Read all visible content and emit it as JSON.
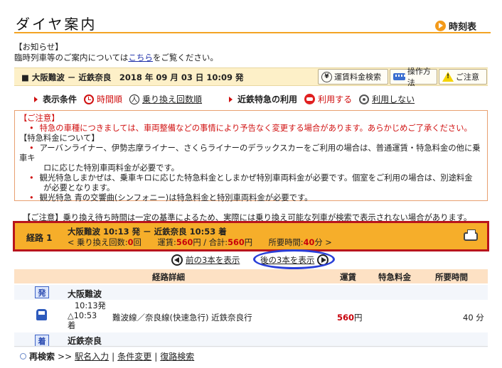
{
  "header": {
    "title": "ダイヤ案内",
    "timetable_link": "時刻表"
  },
  "notice": {
    "heading": "【お知らせ】",
    "text_before": "臨時列車等のご案内については",
    "link": "こちら",
    "text_after": "をご覧ください。"
  },
  "condition": {
    "summary": "■ 大阪難波 － 近鉄奈良　2018 年 09 月 03 日 10:09 発",
    "fare_search": "運賃料金検索",
    "how_to": "操作方法",
    "caution": "ご注意"
  },
  "options": {
    "display_label": "表示条件",
    "time_order": "時間順",
    "transfer_count_order": "乗り換え回数順",
    "express_label": "近鉄特急の利用",
    "use": "利用する",
    "no_use": "利用しない"
  },
  "caution_box": {
    "heading": "【ご注意】",
    "line1": "特急の車種につきましては、車両整備などの事情により予告なく変更する場合があります。あらかじめご了承ください。",
    "fare_heading": "【特急料金について】",
    "bullet1a": "アーバンライナー、伊勢志摩ライナー、さくらライナーのデラックスカーをご利用の場合は、普通運賃・特急料金の他に乗車キ",
    "bullet1b": "ロに応じた特別車両料金が必要です。",
    "bullet2a": "観光特急しまかぜは、乗車キロに応じた特急料金としまかぜ特別車両料金が必要です。個室をご利用の場合は、別途料金",
    "bullet2b": "が必要となります。",
    "bullet3": "観光特急 青の交響曲(シンフォニー)は特急料金と特別車両料金が必要です。"
  },
  "transfer_note": "【ご注意】乗り換え待ち時間は一定の基準によるため、実際には乗り換え可能な列車が検索で表示されない場合があります。",
  "route": {
    "label": "経路 1",
    "summary": "大阪難波 10:13 発 － 近鉄奈良 10:53 着",
    "transfers_prefix": "< 乗り換え回数:",
    "transfers": "0",
    "transfers_unit": "回　　運賃:",
    "fare": "560",
    "fare_unit": "円 / 合計:",
    "total": "560",
    "total_unit": "円　　所要時間:",
    "duration": "40",
    "duration_unit": "分 >"
  },
  "pager": {
    "prev": "前の3本を表示",
    "next": "後の3本を表示"
  },
  "table": {
    "col_detail": "経路詳細",
    "col_fare": "運賃",
    "col_express": "特急料金",
    "col_time": "所要時間"
  },
  "segment": {
    "dep_badge": "発",
    "dep_station": "大阪難波",
    "dep_time": "10:13発",
    "arr_time": "△10:53",
    "arr_suffix": "着",
    "line": "難波線／奈良線(快速急行) 近鉄奈良行",
    "fare": "560",
    "fare_unit": "円",
    "duration": "40 分",
    "arr_badge": "着",
    "arr_station": "近鉄奈良"
  },
  "footer": {
    "research": "再検索",
    "sep": ">>",
    "station_input": "駅名入力",
    "condition_change": "条件変更",
    "return_search": "復路検索"
  }
}
